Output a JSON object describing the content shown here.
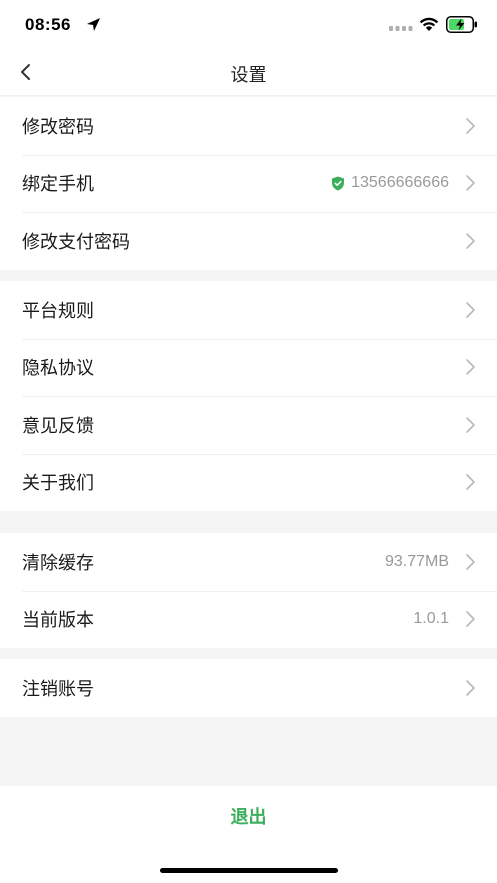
{
  "status_bar": {
    "time": "08:56",
    "icons": [
      "location-arrow-icon",
      "cellular-signal-icon",
      "wifi-icon",
      "battery-charging-icon"
    ]
  },
  "nav": {
    "title": "设置",
    "back_icon": "chevron-left-icon"
  },
  "groups": [
    {
      "items": [
        {
          "label": "修改密码",
          "value": ""
        },
        {
          "label": "绑定手机",
          "value": "13566666666",
          "icon": "shield-check-icon"
        },
        {
          "label": "修改支付密码",
          "value": ""
        }
      ]
    },
    {
      "items": [
        {
          "label": "平台规则",
          "value": ""
        },
        {
          "label": "隐私协议",
          "value": ""
        },
        {
          "label": "意见反馈",
          "value": ""
        },
        {
          "label": "关于我们",
          "value": ""
        }
      ]
    },
    {
      "items": [
        {
          "label": "清除缓存",
          "value": "93.77MB"
        },
        {
          "label": "当前版本",
          "value": "1.0.1"
        }
      ]
    },
    {
      "items": [
        {
          "label": "注销账号",
          "value": ""
        }
      ]
    }
  ],
  "logout": {
    "label": "退出"
  },
  "colors": {
    "accent_green": "#3dae5c",
    "background": "#f5f5f5",
    "value_text": "#999999",
    "chevron": "#b8b8b8"
  }
}
